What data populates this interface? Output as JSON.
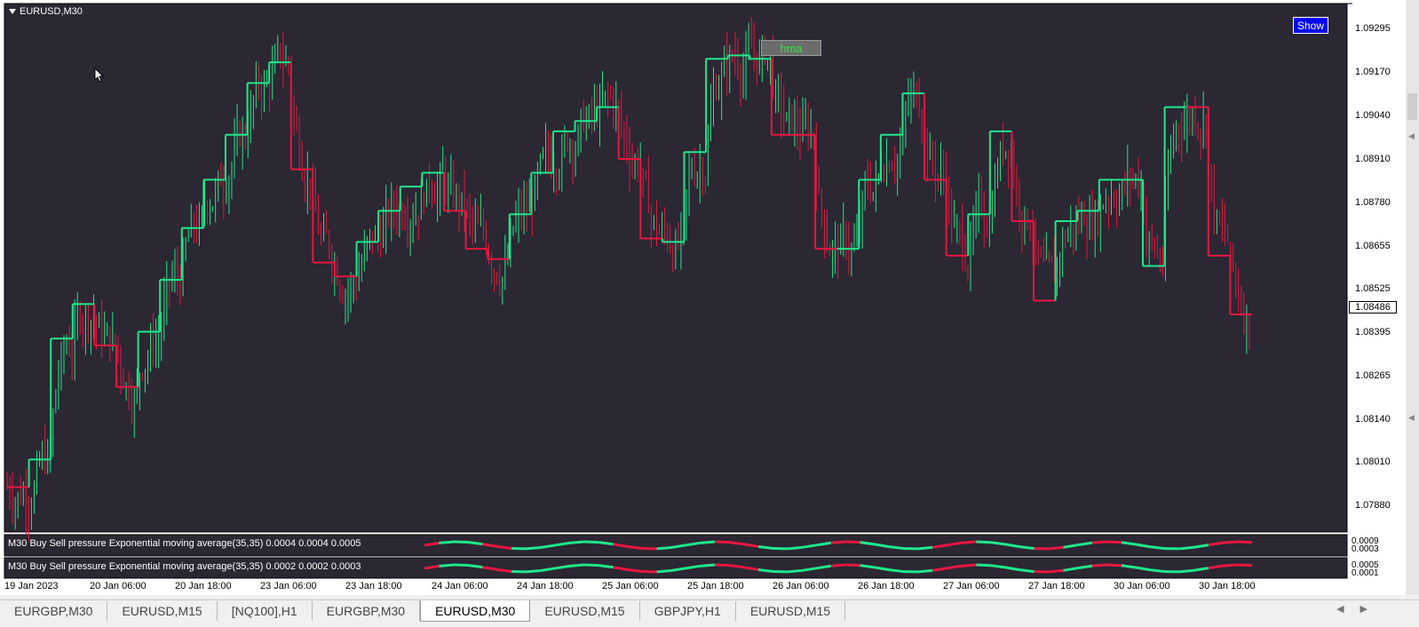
{
  "window": {
    "symbol_title": "EURUSD,M30"
  },
  "show_button": {
    "label": "Show"
  },
  "hma_label": "hma",
  "current_price": "1.08486",
  "price_axis": [
    "1.09295",
    "1.09170",
    "1.09040",
    "1.08910",
    "1.08780",
    "1.08655",
    "1.08525",
    "1.08395",
    "1.08265",
    "1.08140",
    "1.08010",
    "1.07880"
  ],
  "time_axis": [
    "19 Jan 2023",
    "20 Jan 06:00",
    "20 Jan 18:00",
    "23 Jan 06:00",
    "23 Jan 18:00",
    "24 Jan 06:00",
    "24 Jan 18:00",
    "25 Jan 06:00",
    "25 Jan 18:00",
    "26 Jan 06:00",
    "26 Jan 18:00",
    "27 Jan 06:00",
    "27 Jan 18:00",
    "30 Jan 06:00",
    "30 Jan 18:00"
  ],
  "indicators": [
    {
      "label": "M30 Buy Sell pressure Exponential moving average(35,35) 0.0004 0.0004 0.0005",
      "scale_top": "0.0009",
      "scale_bottom": "0.0003"
    },
    {
      "label": "M30 Buy Sell pressure Exponential moving average(35,35) 0.0002 0.0002 0.0003",
      "scale_top": "0.0005",
      "scale_bottom": "0.0001"
    }
  ],
  "tabs": [
    {
      "label": "EURGBP,M30",
      "active": false
    },
    {
      "label": "EURUSD,M15",
      "active": false
    },
    {
      "label": "[NQ100],H1",
      "active": false
    },
    {
      "label": "EURGBP,M30",
      "active": false
    },
    {
      "label": "EURUSD,M30",
      "active": true
    },
    {
      "label": "EURUSD,M15",
      "active": false
    },
    {
      "label": "GBPJPY,H1",
      "active": false
    },
    {
      "label": "EURUSD,M15",
      "active": false
    }
  ],
  "colors": {
    "background": "#2b2733",
    "bull": "#1fe88a",
    "bear": "#e8163f",
    "neutral": "#ffffff"
  },
  "chart_data": {
    "type": "line",
    "title": "EURUSD,M30",
    "ylim": [
      1.078,
      1.0933
    ],
    "hma_steps": [
      [
        1.0793,
        "bear"
      ],
      [
        1.0801,
        "bull"
      ],
      [
        1.0836,
        "bull"
      ],
      [
        1.0846,
        "bull"
      ],
      [
        1.0834,
        "bear"
      ],
      [
        1.0822,
        "bear"
      ],
      [
        1.0838,
        "bull"
      ],
      [
        1.0853,
        "bull"
      ],
      [
        1.0868,
        "bull"
      ],
      [
        1.0882,
        "bull"
      ],
      [
        1.0895,
        "bull"
      ],
      [
        1.091,
        "bull"
      ],
      [
        1.0916,
        "bull"
      ],
      [
        1.0885,
        "bear"
      ],
      [
        1.0858,
        "bear"
      ],
      [
        1.0854,
        "bear"
      ],
      [
        1.0864,
        "bull"
      ],
      [
        1.0873,
        "bull"
      ],
      [
        1.088,
        "bull"
      ],
      [
        1.0884,
        "bull"
      ],
      [
        1.0873,
        "bear"
      ],
      [
        1.0862,
        "bear"
      ],
      [
        1.0859,
        "bear"
      ],
      [
        1.0872,
        "bull"
      ],
      [
        1.0884,
        "bull"
      ],
      [
        1.0896,
        "bull"
      ],
      [
        1.0899,
        "bull"
      ],
      [
        1.0903,
        "bull"
      ],
      [
        1.0888,
        "bear"
      ],
      [
        1.0865,
        "bear"
      ],
      [
        1.0864,
        "bull"
      ],
      [
        1.089,
        "bull"
      ],
      [
        1.0917,
        "bull"
      ],
      [
        1.0918,
        "bull"
      ],
      [
        1.0917,
        "bull"
      ],
      [
        1.0895,
        "bear"
      ],
      [
        1.0895,
        "bear"
      ],
      [
        1.0862,
        "bear"
      ],
      [
        1.0862,
        "bull"
      ],
      [
        1.0882,
        "bull"
      ],
      [
        1.0895,
        "bull"
      ],
      [
        1.0907,
        "bull"
      ],
      [
        1.0882,
        "bear"
      ],
      [
        1.086,
        "bear"
      ],
      [
        1.0872,
        "bull"
      ],
      [
        1.0896,
        "bull"
      ],
      [
        1.087,
        "bear"
      ],
      [
        1.0847,
        "bear"
      ],
      [
        1.087,
        "bull"
      ],
      [
        1.0873,
        "bull"
      ],
      [
        1.0882,
        "bull"
      ],
      [
        1.0882,
        "bull"
      ],
      [
        1.0857,
        "bull"
      ],
      [
        1.0903,
        "bull"
      ],
      [
        1.0903,
        "bear"
      ],
      [
        1.086,
        "bear"
      ],
      [
        1.0843,
        "bear"
      ]
    ]
  }
}
